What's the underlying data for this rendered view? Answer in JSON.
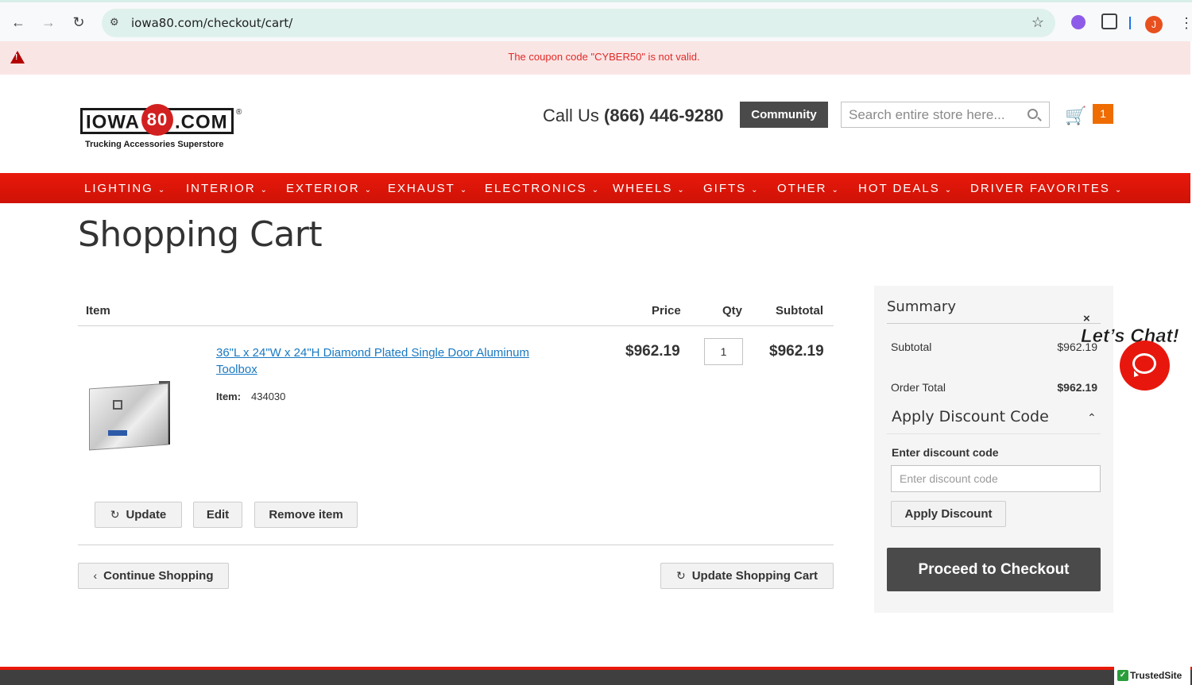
{
  "browser": {
    "url": "iowa80.com/checkout/cart/",
    "profile_initial": "J",
    "icons": [
      "back-arrow-icon",
      "forward-arrow-icon",
      "reload-icon",
      "site-info-icon",
      "bookmark-star-icon",
      "extensions-icon",
      "menu-dots-icon"
    ]
  },
  "alert": {
    "message": "The coupon code \"CYBER50\" is not valid.",
    "color": "#e02b27"
  },
  "header": {
    "logo_left": "IOWA",
    "logo_num": "80",
    "logo_right": ".COM",
    "logo_reg": "®",
    "tagline": "Trucking Accessories Superstore",
    "call_label": "Call Us ",
    "phone": "(866) 446-9280",
    "community_label": "Community",
    "search_placeholder": "Search entire store here...",
    "cart_count": "1"
  },
  "nav": {
    "color": "#e8190b",
    "items": [
      "LIGHTING",
      "INTERIOR",
      "EXTERIOR",
      "EXHAUST",
      "ELECTRONICS",
      "WHEELS",
      "GIFTS",
      "OTHER",
      "HOT DEALS",
      "DRIVER FAVORITES"
    ]
  },
  "cart": {
    "title": "Shopping Cart",
    "columns": {
      "item": "Item",
      "price": "Price",
      "qty": "Qty",
      "subtotal": "Subtotal"
    },
    "items": [
      {
        "name": "36\"L x 24\"W x 24\"H Diamond Plated Single Door Aluminum Toolbox",
        "sku_label": "Item:",
        "sku": "434030",
        "price": "$962.19",
        "qty": "1",
        "subtotal": "$962.19"
      }
    ],
    "actions": {
      "update": "Update",
      "edit": "Edit",
      "remove": "Remove item"
    },
    "continue_label": "Continue Shopping",
    "update_cart_label": "Update Shopping Cart"
  },
  "summary": {
    "title": "Summary",
    "subtotal_label": "Subtotal",
    "subtotal_value": "$962.19",
    "order_total_label": "Order Total",
    "order_total_value": "$962.19",
    "discount_title": "Apply Discount Code",
    "discount_label": "Enter discount code",
    "discount_placeholder": "Enter discount code",
    "apply_label": "Apply Discount",
    "checkout_label": "Proceed to Checkout"
  },
  "chat": {
    "label": "Let’s Chat!",
    "close": "×"
  },
  "footer": {
    "trusted_label": "TrustedSite"
  }
}
